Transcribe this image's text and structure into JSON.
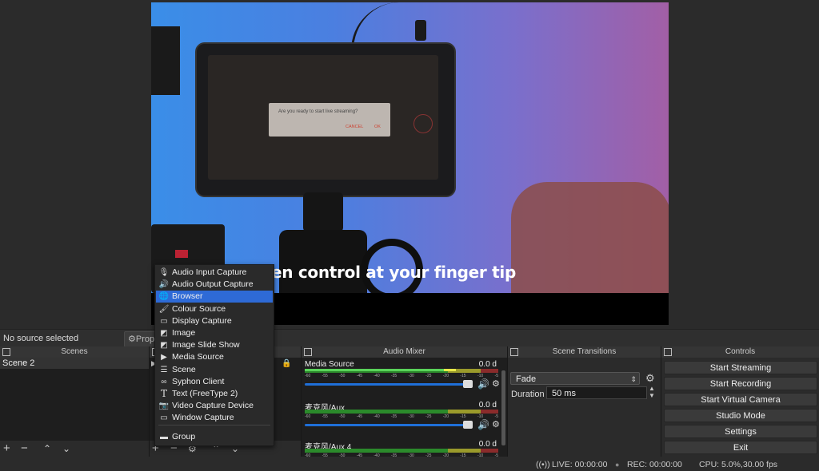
{
  "preview": {
    "caption": "en control at your finger tip",
    "dialog_text": "Are you ready to start live streaming?",
    "dialog_cancel": "CANCEL",
    "dialog_ok": "OK"
  },
  "source_bar": {
    "no_source": "No source selected",
    "properties": "Prop"
  },
  "docks": {
    "scenes_title": "Scenes",
    "scenes": [
      "Scene 2"
    ],
    "mixer_title": "Audio Mixer",
    "transitions_title": "Scene Transitions",
    "controls_title": "Controls"
  },
  "mixer": {
    "channels": [
      {
        "name": "Media Source",
        "db": "0.0 d",
        "level": 0.78
      },
      {
        "name": "麦克风/Aux",
        "db": "0.0 d",
        "level": 0.0
      },
      {
        "name": "麦克风/Aux 4",
        "db": "0.0 d",
        "level": 0.0
      }
    ],
    "ticks": [
      "-60",
      "-55",
      "-50",
      "-45",
      "-40",
      "-35",
      "-30",
      "-25",
      "-20",
      "-15",
      "-10",
      "-5"
    ]
  },
  "transitions": {
    "selected": "Fade",
    "duration_label": "Duration",
    "duration_value": "50 ms"
  },
  "controls": {
    "start_streaming": "Start Streaming",
    "start_recording": "Start Recording",
    "start_virtual_camera": "Start Virtual Camera",
    "studio_mode": "Studio Mode",
    "settings": "Settings",
    "exit": "Exit"
  },
  "status": {
    "live": "LIVE: 00:00:00",
    "rec": "REC: 00:00:00",
    "cpu": "CPU: 5.0%,30.00 fps"
  },
  "menu": {
    "items": [
      {
        "label": "Audio Input Capture",
        "icon": "microphone-icon"
      },
      {
        "label": "Audio Output Capture",
        "icon": "speaker-icon"
      },
      {
        "label": "Browser",
        "icon": "globe-icon"
      },
      {
        "label": "Colour Source",
        "icon": "brush-icon"
      },
      {
        "label": "Display Capture",
        "icon": "monitor-icon"
      },
      {
        "label": "Image",
        "icon": "image-icon"
      },
      {
        "label": "Image Slide Show",
        "icon": "slideshow-icon"
      },
      {
        "label": "Media Source",
        "icon": "play-icon"
      },
      {
        "label": "Scene",
        "icon": "list-icon"
      },
      {
        "label": "Syphon Client",
        "icon": "link-icon"
      },
      {
        "label": "Text (FreeType 2)",
        "icon": "text-icon"
      },
      {
        "label": "Video Capture Device",
        "icon": "camera-icon"
      },
      {
        "label": "Window Capture",
        "icon": "window-icon"
      }
    ],
    "group": "Group",
    "highlight_color": "#2e6ad6"
  }
}
